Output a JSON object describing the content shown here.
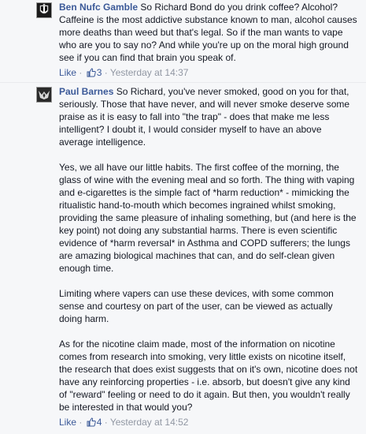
{
  "comments": [
    {
      "author": "Ben Nufc Gamble",
      "avatar_icon": "newcastle-crest-icon",
      "paragraphs": [
        "So Richard Bond do you drink coffee? Alcohol? Caffeine is the most addictive substance known to man, alcohol causes more deaths than weed but that's legal. So if the man wants to vape who are you to say no? And while you're up on the moral high ground see if you can find that brain you speak of."
      ],
      "like_label": "Like",
      "separator": " · ",
      "like_count": "3",
      "timestamp": "Yesterday at 14:37"
    },
    {
      "author": "Paul Barnes",
      "avatar_icon": "winged-emblem-icon",
      "paragraphs": [
        "So Richard, you've never smoked, good on you for that, seriously. Those that have never, and will never smoke deserve some praise as it is easy to fall into \"the trap\" - does that make me less intelligent? I doubt it, I would consider myself to have an above average intelligence.",
        "Yes, we all have our little habits. The first coffee of the morning, the glass of wine with the evening meal and so forth. The thing with vaping and e-cigarettes is the simple fact of *harm reduction* - mimicking the ritualistic hand-to-mouth which becomes ingrained whilst smoking, providing the same pleasure of inhaling something, but (and here is the key point) not doing any substantial harms. There is even scientific evidence of *harm reversal* in Asthma and COPD sufferers; the lungs are amazing biological machines that can, and do self-clean given enough time.",
        "Limiting where vapers can use these devices, with some common sense and courtesy on part of the user, can be viewed as actually doing harm.",
        "As for the nicotine claim made, most of the information on nicotine comes from research into smoking, very little exists on nicotine itself, the research that does exist suggests that on it's own, nicotine does not have any reinforcing properties - i.e. absorb, but doesn't give any kind of \"reward\" feeling or need to do it again. But then, you wouldn't really be interested in that would you?"
      ],
      "like_label": "Like",
      "separator": " · ",
      "like_count": "4",
      "timestamp": "Yesterday at 14:52"
    }
  ],
  "colors": {
    "link": "#3b5998",
    "meta": "#9197a3",
    "text": "#141823",
    "background": "#f6f7f9"
  }
}
